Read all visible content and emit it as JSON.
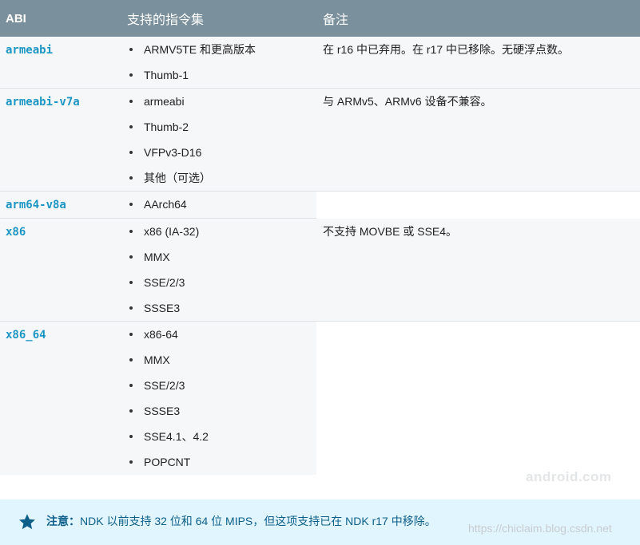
{
  "table": {
    "headers": {
      "abi": "ABI",
      "instructions": "支持的指令集",
      "notes": "备注"
    },
    "rows": [
      {
        "abi": "armeabi",
        "instructions": [
          "ARMV5TE 和更高版本",
          "Thumb-1"
        ],
        "note": "在 r16 中已弃用。在 r17 中已移除。无硬浮点数。"
      },
      {
        "abi": "armeabi-v7a",
        "instructions": [
          "armeabi",
          "Thumb-2",
          "VFPv3-D16",
          "其他（可选）"
        ],
        "note": "与 ARMv5、ARMv6 设备不兼容。"
      },
      {
        "abi": "arm64-v8a",
        "instructions": [
          "AArch64"
        ],
        "note": ""
      },
      {
        "abi": "x86",
        "instructions": [
          "x86 (IA-32)",
          "MMX",
          "SSE/2/3",
          "SSSE3"
        ],
        "note": "不支持 MOVBE 或 SSE4。"
      },
      {
        "abi": "x86_64",
        "instructions": [
          "x86-64",
          "MMX",
          "SSE/2/3",
          "SSSE3",
          "SSE4.1、4.2",
          "POPCNT"
        ],
        "note": ""
      }
    ]
  },
  "notice": {
    "icon": "star-icon",
    "label": "注意：",
    "text": "NDK 以前支持 32 位和 64 位 MIPS，但这项支持已在 NDK r17 中移除。"
  },
  "watermarks": {
    "site": "android.com",
    "url": "https://chiclaim.blog.csdn.net"
  },
  "colors": {
    "header_bg": "#7a909c",
    "abi_name": "#1e96c4",
    "notice_bg": "#e1f5fe",
    "notice_text": "#0d5f8a",
    "row_bg": "#f6f7f9"
  }
}
